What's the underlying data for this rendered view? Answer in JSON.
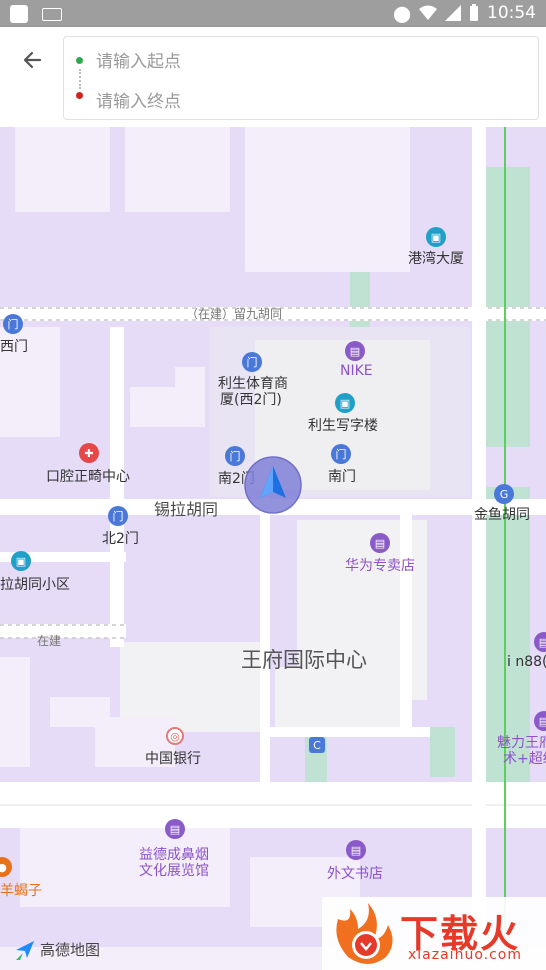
{
  "status_bar": {
    "time": "10:54",
    "icons": [
      "app-icon",
      "keyboard-icon",
      "location-icon",
      "wifi-icon",
      "signal-icon",
      "battery-icon"
    ]
  },
  "header": {
    "back_icon": "arrow-left-icon",
    "start_placeholder": "请输入起点",
    "end_placeholder": "请输入终点",
    "start_dot_color": "#2fa84f",
    "end_dot_color": "#d32020"
  },
  "map": {
    "labels": {
      "gangwan": "港湾大厦",
      "liujiu_road": "（在建）留九胡同",
      "ximen": "西门",
      "nike": "NIKE",
      "lisheng_sports": "利生体育商",
      "lisheng_sports2": "厦(西2门)",
      "lisheng_office": "利生写字楼",
      "dental": "口腔正畸中心",
      "nan2men": "南2门",
      "nanmen": "南门",
      "jinyu": "金鱼胡同",
      "xila": "锡拉胡同",
      "bei2men": "北2门",
      "huawei": "华为专卖店",
      "xila_xiaoqu": "拉胡同小区",
      "zaijian": "在建",
      "wangfu": "王府国际中心",
      "in88": "i n88(",
      "meili1": "魅力王府",
      "meili2": "术+超级",
      "bank": "中国银行",
      "yidecheng1": "益德成鼻烟",
      "yidecheng2": "文化展览馆",
      "waiwen": "外文书店",
      "yangxiezi": "羊蝎子"
    },
    "attribution": "高德地图"
  },
  "watermark": {
    "title": "下载火",
    "subtitle": "xiazaihuo.com"
  }
}
